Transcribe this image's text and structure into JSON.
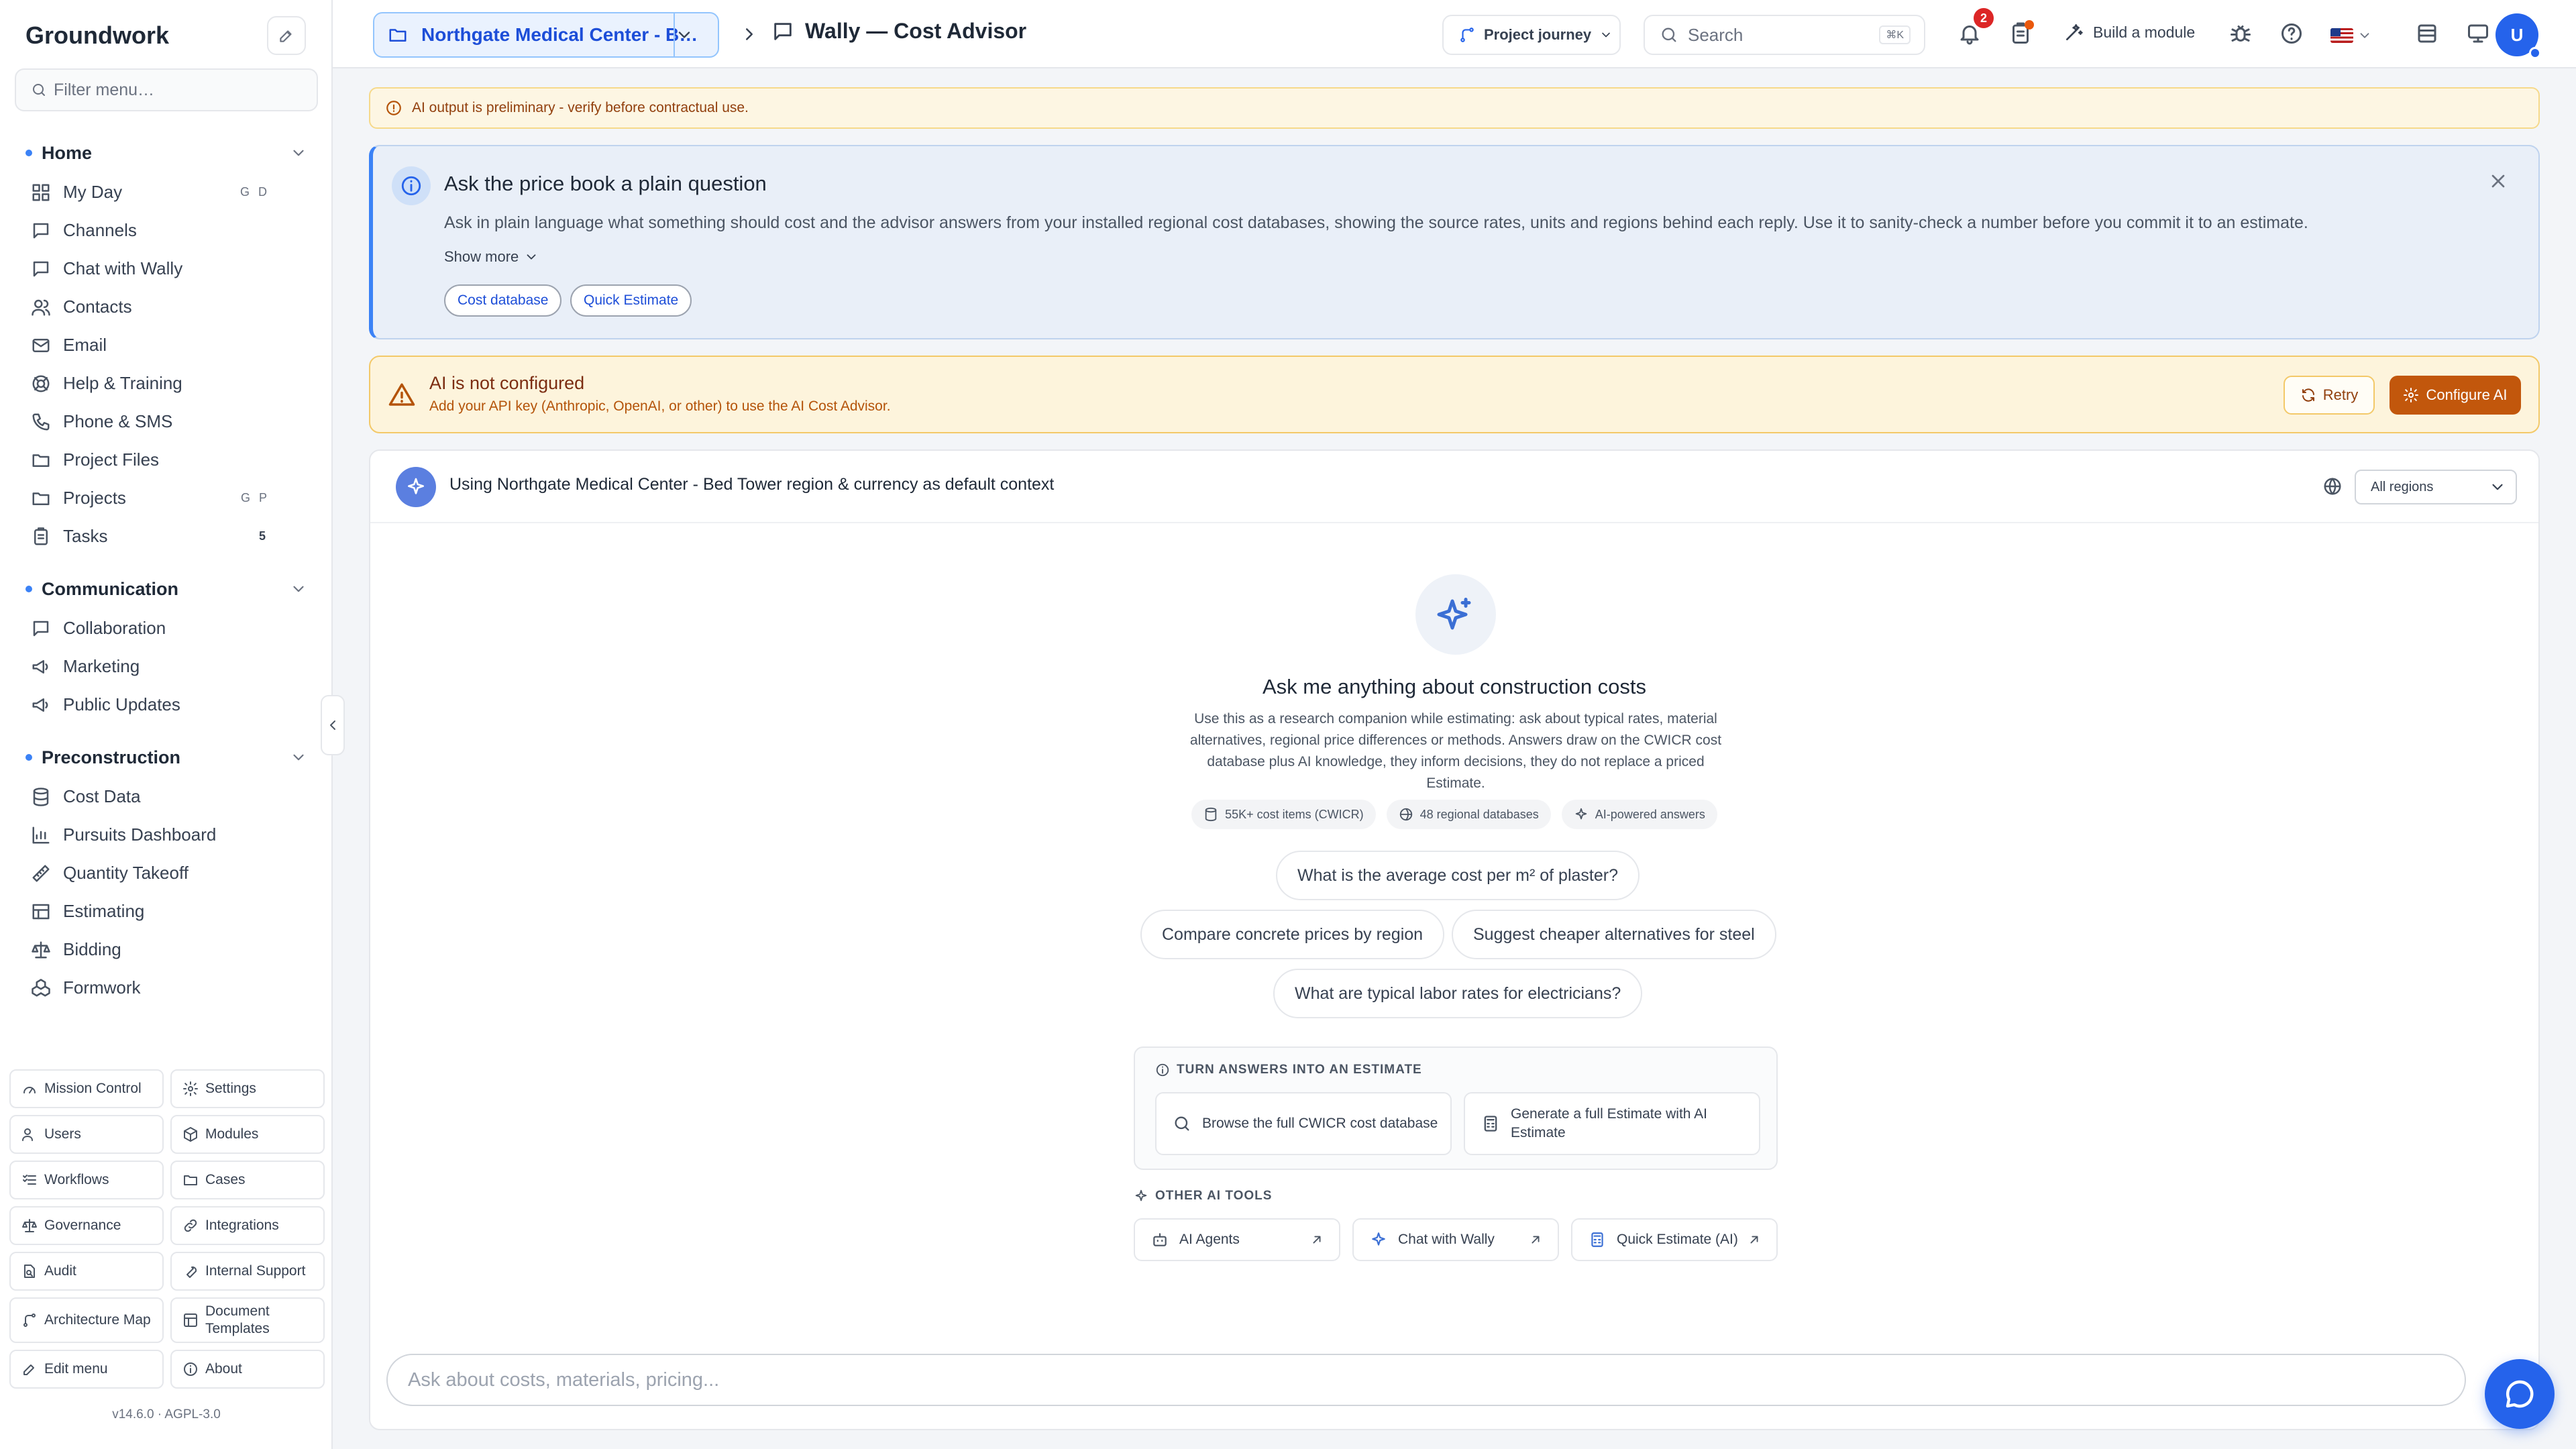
{
  "sidebar": {
    "brand": "Groundwork",
    "filter_placeholder": "Filter menu…",
    "sections": [
      {
        "title": "Home",
        "items": [
          {
            "label": "My Day",
            "icon": "dashboard-icon",
            "shortcut": "G D"
          },
          {
            "label": "Channels",
            "icon": "chat-icon"
          },
          {
            "label": "Chat with Wally",
            "icon": "chat-icon"
          },
          {
            "label": "Contacts",
            "icon": "users-icon"
          },
          {
            "label": "Email",
            "icon": "mail-icon"
          },
          {
            "label": "Help & Training",
            "icon": "lifebuoy-icon"
          },
          {
            "label": "Phone & SMS",
            "icon": "phone-icon"
          },
          {
            "label": "Project Files",
            "icon": "folder-icon"
          },
          {
            "label": "Projects",
            "icon": "folder-icon",
            "shortcut": "G P"
          },
          {
            "label": "Tasks",
            "icon": "clipboard-icon",
            "count": "5"
          }
        ]
      },
      {
        "title": "Communication",
        "items": [
          {
            "label": "Collaboration",
            "icon": "chat-icon"
          },
          {
            "label": "Marketing",
            "icon": "megaphone-icon"
          },
          {
            "label": "Public Updates",
            "icon": "megaphone-icon"
          }
        ]
      },
      {
        "title": "Preconstruction",
        "items": [
          {
            "label": "Cost Data",
            "icon": "database-icon"
          },
          {
            "label": "Pursuits Dashboard",
            "icon": "chart-icon"
          },
          {
            "label": "Quantity Takeoff",
            "icon": "ruler-icon"
          },
          {
            "label": "Estimating",
            "icon": "table-icon"
          },
          {
            "label": "Bidding",
            "icon": "scale-icon"
          },
          {
            "label": "Formwork",
            "icon": "cubes-icon"
          }
        ]
      }
    ],
    "quick": [
      {
        "label": "Mission Control",
        "icon": "gauge-icon"
      },
      {
        "label": "Settings",
        "icon": "gear-icon"
      },
      {
        "label": "Users",
        "icon": "users-icon"
      },
      {
        "label": "Modules",
        "icon": "box-icon"
      },
      {
        "label": "Workflows",
        "icon": "list-check-icon"
      },
      {
        "label": "Cases",
        "icon": "folder-icon"
      },
      {
        "label": "Governance",
        "icon": "scale-icon"
      },
      {
        "label": "Integrations",
        "icon": "link-icon"
      },
      {
        "label": "Audit",
        "icon": "file-search-icon"
      },
      {
        "label": "Internal Support",
        "icon": "wrench-icon"
      },
      {
        "label": "Architecture Map",
        "icon": "route-icon"
      },
      {
        "label": "Document Templates",
        "icon": "template-icon"
      },
      {
        "label": "Edit menu",
        "icon": "pencil-icon"
      },
      {
        "label": "About",
        "icon": "info-icon"
      }
    ],
    "version": "v14.6.0  ·  AGPL-3.0"
  },
  "topbar": {
    "project": "Northgate Medical Center - B…",
    "page_title": "Wally — Cost Advisor",
    "journey": "Project journey",
    "search_placeholder": "Search",
    "search_kbd": "⌘K",
    "notif_count": "2",
    "build": "Build a module",
    "avatar": "U"
  },
  "banner": {
    "prelim": "AI output is preliminary - verify before contractual use."
  },
  "info": {
    "title": "Ask the price book a plain question",
    "body": "Ask in plain language what something should cost and the advisor answers from your installed regional cost databases, showing the source rates, units and regions behind each reply. Use it to sanity-check a number before you commit it to an estimate.",
    "more": "Show more",
    "pills": [
      "Cost database",
      "Quick Estimate"
    ]
  },
  "warning": {
    "title": "AI is not configured",
    "body": "Add your API key (Anthropic, OpenAI, or other) to use the AI Cost Advisor.",
    "retry": "Retry",
    "configure": "Configure AI"
  },
  "context": {
    "text": "Using Northgate Medical Center - Bed Tower region & currency as default context",
    "region": "All regions"
  },
  "empty": {
    "title": "Ask me anything about construction costs",
    "desc": "Use this as a research companion while estimating: ask about typical rates, material alternatives, regional price differences or methods. Answers draw on the CWICR cost database plus AI knowledge, they inform decisions, they do not replace a priced Estimate.",
    "chips": [
      "55K+ cost items (CWICR)",
      "48 regional databases",
      "AI-powered answers"
    ],
    "suggestions": [
      "What is the average cost per m² of plaster?",
      "Compare concrete prices by region",
      "Suggest cheaper alternatives for steel",
      "What are typical labor rates for electricians?"
    ],
    "turn_title": "TURN ANSWERS INTO AN ESTIMATE",
    "turn_actions": [
      "Browse the full CWICR cost database",
      "Generate a full Estimate with AI Estimate"
    ],
    "other_title": "OTHER AI TOOLS",
    "other_tools": [
      "AI Agents",
      "Chat with Wally",
      "Quick Estimate (AI)"
    ]
  },
  "composer": {
    "placeholder": "Ask about costs, materials, pricing..."
  },
  "colors": {
    "accent": "#2563eb",
    "warning": "#c2570c",
    "info_bg": "#e9eff8"
  }
}
